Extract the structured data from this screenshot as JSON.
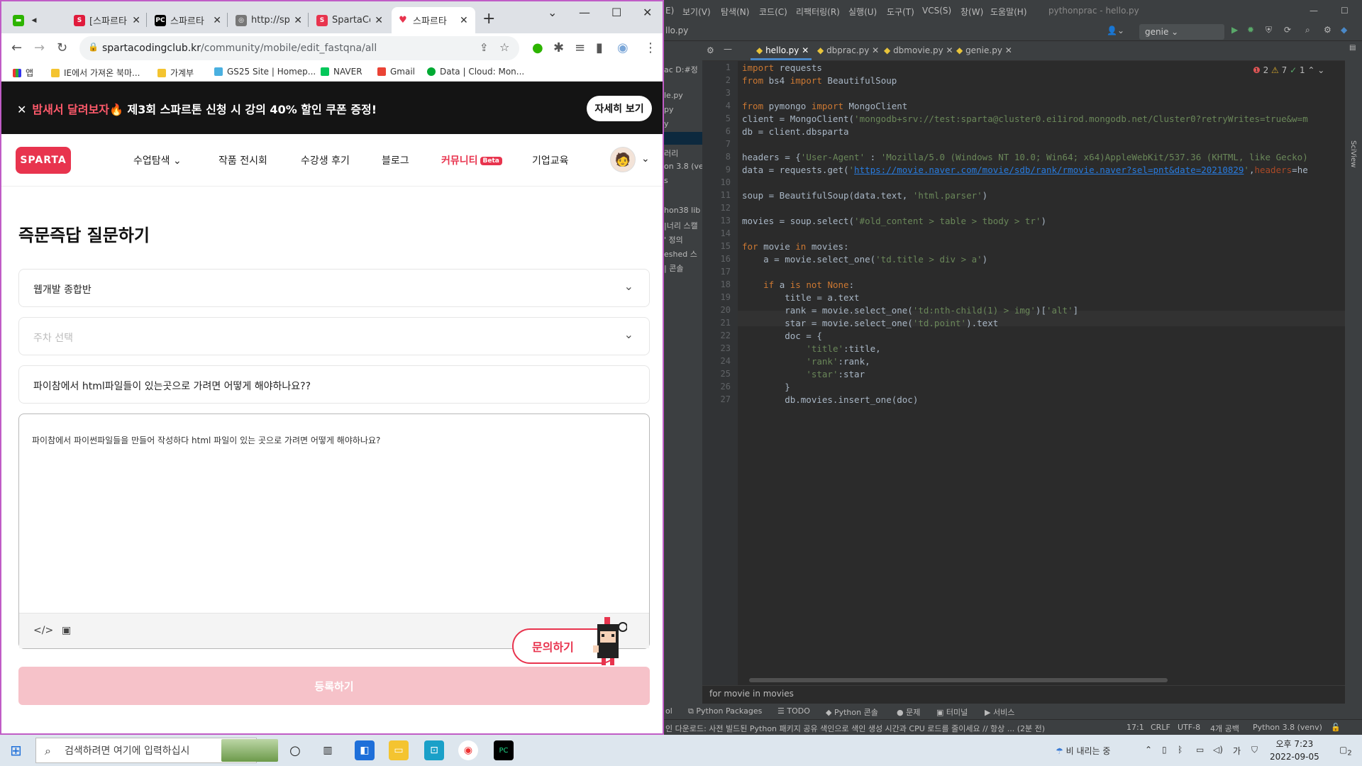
{
  "browser": {
    "tabs": [
      {
        "label": "[스파르타",
        "favicon": "S",
        "color": "#e01b3c"
      },
      {
        "label": "스파르타",
        "favicon": "PC",
        "color": "#000000"
      },
      {
        "label": "http://sp",
        "favicon": "◎",
        "color": "#777777"
      },
      {
        "label": "SpartaCo",
        "favicon": "S",
        "color": "#e8344e"
      },
      {
        "label": "스파르타",
        "favicon": "♥",
        "color": "#e8344e"
      }
    ],
    "url_domain": "spartacodingclub.kr",
    "url_path": "/community/mobile/edit_fastqna/all",
    "bookmarks": [
      "앱",
      "IE에서 가져온 북마...",
      "가계부",
      "GS25 Site | Homep...",
      "NAVER",
      "Gmail",
      "Data | Cloud: Mon..."
    ]
  },
  "page": {
    "banner_prefix": "밤새서 달려보자🔥",
    "banner_main": "제3회 스파르톤 신청 시 강의 40% 할인 쿠폰 증정!",
    "banner_button": "자세히 보기",
    "logo": "SPARTA",
    "nav": [
      "수업탐색",
      "작품 전시회",
      "수강생 후기",
      "블로그",
      "커뮤니티",
      "기업교육"
    ],
    "nav_beta": "Beta",
    "title": "즉문즉답 질문하기",
    "course_select": "웹개발 종합반",
    "week_placeholder": "주차 선택",
    "question_title": "파이참에서 html파일들이 있는곳으로 가려면 어떻게 해야하나요??",
    "question_body": "파이참에서 파이썬파일들을 만들어 작성하다 html 파일이 있는 곳으로 가려면 어떻게 해야하나요?",
    "ask_button": "문의하기",
    "submit_button": "등록하기"
  },
  "ide": {
    "menus": [
      "보기(V)",
      "탐색(N)",
      "코드(C)",
      "리팩터링(R)",
      "실행(U)",
      "도구(T)",
      "VCS(S)",
      "창(W)",
      "도움말(H)"
    ],
    "title": "pythonprac - hello.py",
    "breadcrumb": "llo.py",
    "run_config": "genie",
    "tabs": [
      "hello.py",
      "dbprac.py",
      "dbmovie.py",
      "genie.py"
    ],
    "project_items": [
      "ac D:#정",
      "le.py",
      "py",
      "y",
      "",
      "러리",
      "on 3.8 (ve",
      "s",
      "",
      "hon38 lib",
      "|너리 스캘",
      "' 정의",
      "eshed 스",
      "| 콘솔"
    ],
    "inspection": "❶ 2  ⚠ 7  ✓ 1",
    "code": [
      "import requests",
      "from bs4 import BeautifulSoup",
      "",
      "from pymongo import MongoClient",
      "client = MongoClient('mongodb+srv://test:sparta@cluster0.ei1irod.mongodb.net/Cluster0?retryWrites=true&w=m",
      "db = client.dbsparta",
      "",
      "headers = {'User-Agent' : 'Mozilla/5.0 (Windows NT 10.0; Win64; x64)AppleWebKit/537.36 (KHTML, like Gecko)",
      "data = requests.get('https://movie.naver.com/movie/sdb/rank/rmovie.naver?sel=pnt&date=20210829',headers=he",
      "",
      "soup = BeautifulSoup(data.text, 'html.parser')",
      "",
      "movies = soup.select('#old_content > table > tbody > tr')",
      "",
      "for movie in movies:",
      "    a = movie.select_one('td.title > div > a')",
      "",
      "    if a is not None:",
      "        title = a.text",
      "        rank = movie.select_one('td:nth-child(1) > img')['alt']",
      "        star = movie.select_one('td.point').text",
      "        doc = {",
      "            'title':title,",
      "            'rank':rank,",
      "            'star':star",
      "        }",
      "        db.movies.insert_one(doc)"
    ],
    "hint": "for movie in movies",
    "bottom_tools": [
      "ol",
      "Python Packages",
      "TODO",
      "Python 콘솔",
      "문제",
      "터미널",
      "서비스"
    ],
    "status_message": "인 다운로드: 사전 빌드된 Python 패키지 공유 색인으로 색인 생성 시간과 CPU 로드를 줄이세요 // 항상 ... (2분 전)",
    "status_right": [
      "17:1",
      "CRLF",
      "UTF-8",
      "4개 공백",
      "Python 3.8 (venv)"
    ]
  },
  "taskbar": {
    "search_placeholder": "검색하려면 여기에 입력하십시",
    "weather": "비 내리는 중",
    "time": "오후 7:23",
    "date": "2022-09-05",
    "notifications": "2"
  }
}
